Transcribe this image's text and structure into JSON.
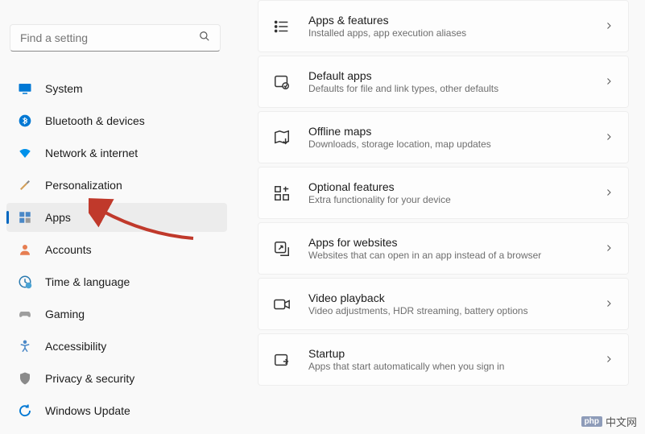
{
  "search": {
    "placeholder": "Find a setting"
  },
  "sidebar": {
    "items": [
      {
        "label": "System"
      },
      {
        "label": "Bluetooth & devices"
      },
      {
        "label": "Network & internet"
      },
      {
        "label": "Personalization"
      },
      {
        "label": "Apps"
      },
      {
        "label": "Accounts"
      },
      {
        "label": "Time & language"
      },
      {
        "label": "Gaming"
      },
      {
        "label": "Accessibility"
      },
      {
        "label": "Privacy & security"
      },
      {
        "label": "Windows Update"
      }
    ]
  },
  "cards": [
    {
      "title": "Apps & features",
      "sub": "Installed apps, app execution aliases"
    },
    {
      "title": "Default apps",
      "sub": "Defaults for file and link types, other defaults"
    },
    {
      "title": "Offline maps",
      "sub": "Downloads, storage location, map updates"
    },
    {
      "title": "Optional features",
      "sub": "Extra functionality for your device"
    },
    {
      "title": "Apps for websites",
      "sub": "Websites that can open in an app instead of a browser"
    },
    {
      "title": "Video playback",
      "sub": "Video adjustments, HDR streaming, battery options"
    },
    {
      "title": "Startup",
      "sub": "Apps that start automatically when you sign in"
    }
  ],
  "watermark": {
    "badge": "php",
    "text": "中文网"
  },
  "colors": {
    "accent": "#0067c0",
    "arrow": "#c0392b"
  }
}
